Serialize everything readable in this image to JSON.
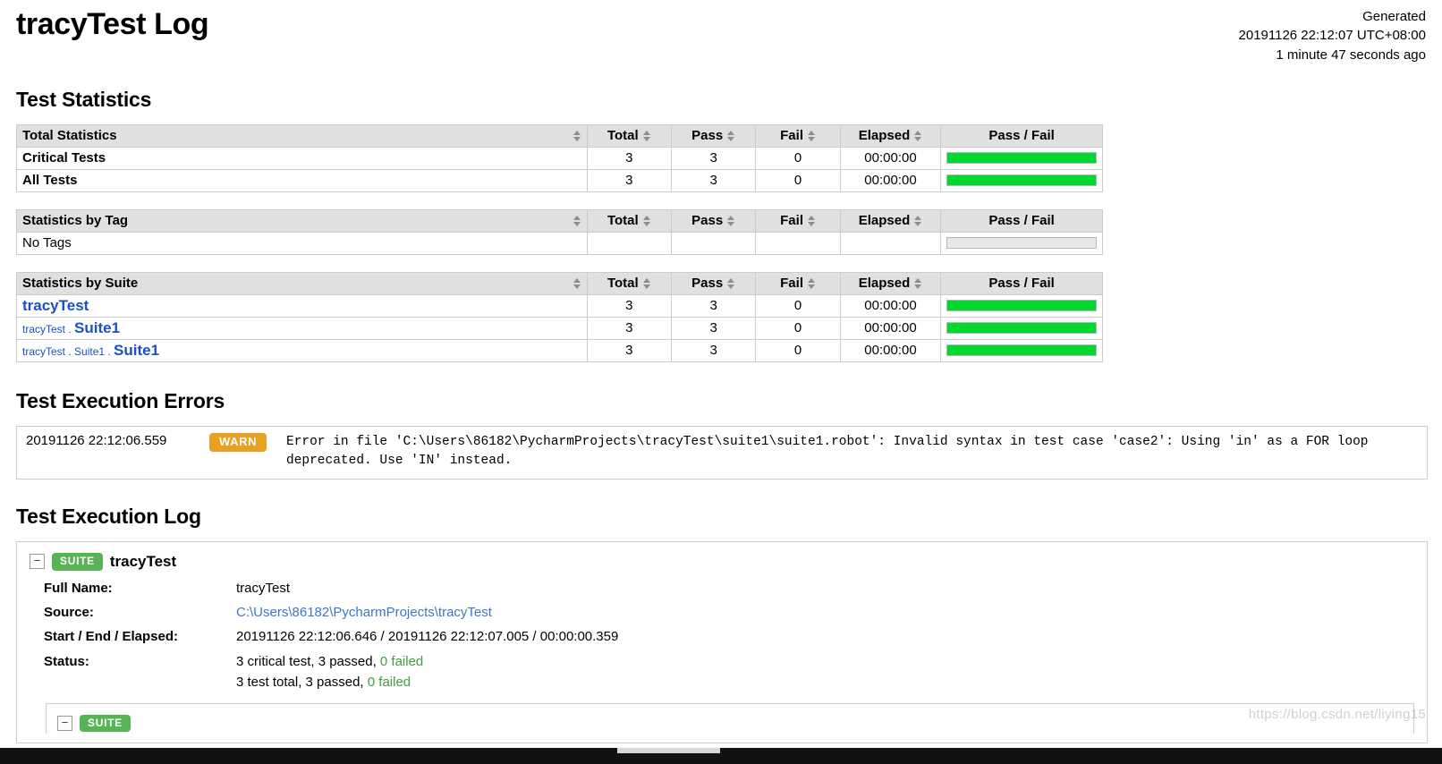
{
  "header": {
    "title": "tracyTest Log",
    "generated_label": "Generated",
    "generated_time": "20191126 22:12:07 UTC+08:00",
    "generated_ago": "1 minute 47 seconds ago"
  },
  "sections": {
    "statistics": "Test Statistics",
    "errors": "Test Execution Errors",
    "log": "Test Execution Log"
  },
  "columns": {
    "total": "Total",
    "pass": "Pass",
    "fail": "Fail",
    "elapsed": "Elapsed",
    "graph": "Pass / Fail"
  },
  "total_statistics": {
    "title": "Total Statistics",
    "rows": [
      {
        "name": "Critical Tests",
        "total": "3",
        "pass": "3",
        "fail": "0",
        "elapsed": "00:00:00",
        "pass_pct": 100,
        "fail_pct": 0
      },
      {
        "name": "All Tests",
        "total": "3",
        "pass": "3",
        "fail": "0",
        "elapsed": "00:00:00",
        "pass_pct": 100,
        "fail_pct": 0
      }
    ]
  },
  "tag_statistics": {
    "title": "Statistics by Tag",
    "rows": [
      {
        "name": "No Tags",
        "total": "",
        "pass": "",
        "fail": "",
        "elapsed": "",
        "pass_pct": 0,
        "fail_pct": 0
      }
    ]
  },
  "suite_statistics": {
    "title": "Statistics by Suite",
    "rows": [
      {
        "parent": "",
        "name": "tracyTest",
        "total": "3",
        "pass": "3",
        "fail": "0",
        "elapsed": "00:00:00",
        "pass_pct": 100,
        "fail_pct": 0
      },
      {
        "parent": "tracyTest . ",
        "name": "Suite1",
        "total": "3",
        "pass": "3",
        "fail": "0",
        "elapsed": "00:00:00",
        "pass_pct": 100,
        "fail_pct": 0
      },
      {
        "parent": "tracyTest . Suite1 . ",
        "name": "Suite1",
        "total": "3",
        "pass": "3",
        "fail": "0",
        "elapsed": "00:00:00",
        "pass_pct": 100,
        "fail_pct": 0
      }
    ]
  },
  "execution_errors": {
    "rows": [
      {
        "timestamp": "20191126 22:12:06.559",
        "level": "WARN",
        "message": "Error in file 'C:\\Users\\86182\\PycharmProjects\\tracyTest\\suite1\\suite1.robot': Invalid syntax in test case 'case2': Using 'in' as a FOR loop\ndeprecated. Use 'IN' instead."
      }
    ]
  },
  "execution_log": {
    "root_suite": {
      "expander": "−",
      "type_badge": "SUITE",
      "name": "tracyTest",
      "meta": [
        {
          "label": "Full Name:",
          "value": "tracyTest",
          "kind": "text"
        },
        {
          "label": "Source:",
          "value": "C:\\Users\\86182\\PycharmProjects\\tracyTest",
          "kind": "link"
        },
        {
          "label": "Start / End / Elapsed:",
          "value": "20191126 22:12:06.646 / 20191126 22:12:07.005 / 00:00:00.359",
          "kind": "text"
        }
      ],
      "status_label": "Status:",
      "status_lines": [
        {
          "prefix": "3 critical test, 3 passed, ",
          "failed": "0 failed"
        },
        {
          "prefix": "3 test total, 3 passed, ",
          "failed": "0 failed"
        }
      ],
      "child": {
        "expander": "−",
        "type_badge": "SUITE"
      }
    }
  },
  "watermark": "https://blog.csdn.net/liying15",
  "colors": {
    "pass_green": "#00d72f",
    "fail_red": "#ff3333",
    "warn_orange": "#e8a022",
    "suite_badge_green": "#56b356",
    "link_blue": "#1a4fcb",
    "header_gray": "#e0e0e0"
  }
}
